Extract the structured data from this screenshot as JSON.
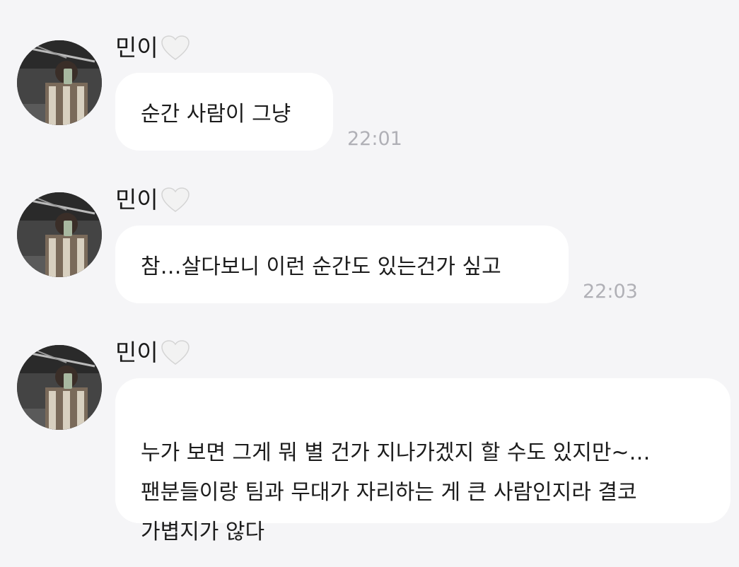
{
  "messages": [
    {
      "sender": "민이",
      "text": "순간 사람이 그냥",
      "time": "22:01"
    },
    {
      "sender": "민이",
      "text": "참…살다보니 이런 순간도 있는건가 싶고",
      "time": "22:03"
    },
    {
      "sender": "민이",
      "text": "누가 보면 그게 뭐 별 건가 지나가겠지 할 수도 있지만~…\n팬분들이랑 팀과 무대가 자리하는 게 큰 사람인지라 결코\n가볍지가 않다",
      "time": ""
    }
  ],
  "icons": {
    "heart": "white-heart-icon",
    "avatar": "profile-avatar"
  },
  "colors": {
    "background": "#f5f5f7",
    "bubble": "#ffffff",
    "timestamp": "#b0b0b6"
  }
}
